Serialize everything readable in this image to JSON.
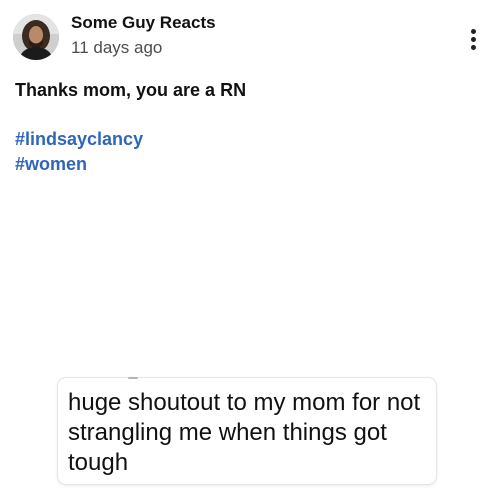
{
  "post": {
    "author": "Some Guy Reacts",
    "time": "11 days ago",
    "text": "Thanks mom, you are a RN",
    "hashtags": [
      "#lindsayclancy",
      "#women"
    ],
    "media_caption": "huge shoutout to my mom for not strangling me when things got tough"
  },
  "icons": {
    "more": "vertical-ellipsis-icon",
    "avatar": "avatar-photo"
  },
  "colors": {
    "hashtag": "#2f66b9",
    "time": "#4d4d4d",
    "text": "#111111"
  }
}
